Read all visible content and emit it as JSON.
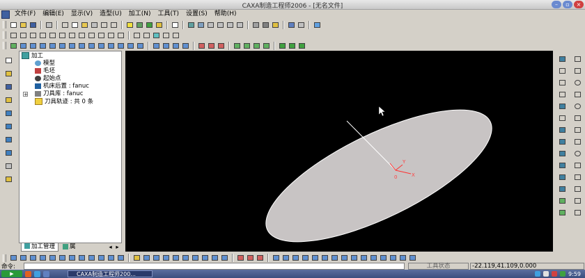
{
  "window": {
    "title": "CAXA制造工程师2006 - [无名文件]"
  },
  "menu": [
    "文件(F)",
    "编辑(E)",
    "显示(V)",
    "造型(U)",
    "加工(N)",
    "工具(T)",
    "设置(S)",
    "帮助(H)"
  ],
  "tree": {
    "root": "加工",
    "items": [
      "模型",
      "毛坯",
      "起始点",
      "机床后置 : fanuc",
      "刀具库 : fanuc",
      "刀具轨迹 : 共 0 条"
    ]
  },
  "tabs": {
    "machining": "加工管理",
    "properties": "属"
  },
  "axes": {
    "x": "X",
    "y": "Y",
    "origin": "0"
  },
  "command": {
    "label": "命令:",
    "status": "工具状态",
    "coords": "-22.119,41.109,0.000"
  },
  "taskbar": {
    "task": "CAXA制造工程师200...",
    "clock": "9:59"
  },
  "colors": {
    "viewport": "#000000",
    "ellipse": "#c8c4c4",
    "axes": "#ff3030",
    "taskbar": "#3a4e7e"
  }
}
